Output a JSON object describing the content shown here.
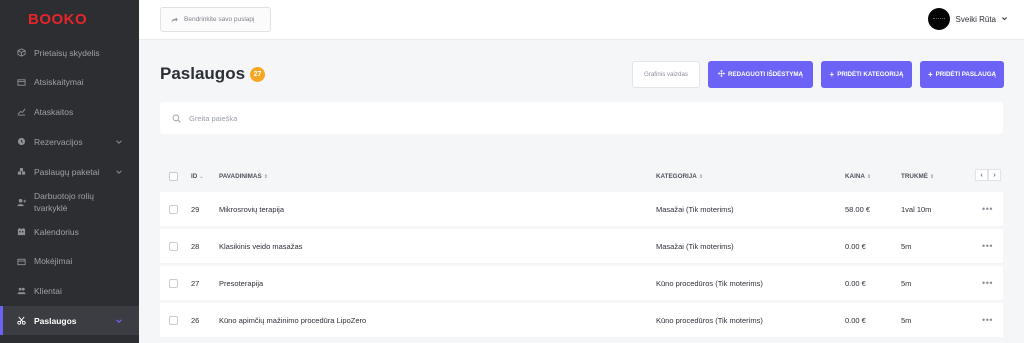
{
  "app": {
    "logo": "BOOKO"
  },
  "sidebar": {
    "items": [
      {
        "label": "Prietaisų skydelis",
        "icon": "cube-icon",
        "chevron": false,
        "active": false
      },
      {
        "label": "Atsiskaitymai",
        "icon": "card-icon",
        "chevron": false,
        "active": false
      },
      {
        "label": "Ataskaitos",
        "icon": "chart-icon",
        "chevron": false,
        "active": false
      },
      {
        "label": "Rezervacijos",
        "icon": "clock-icon",
        "chevron": true,
        "active": false
      },
      {
        "label": "Paslaugų paketai",
        "icon": "box-icon",
        "chevron": true,
        "active": false
      },
      {
        "label": "Darbuotojo rolių tvarkyklė",
        "icon": "user-plus-icon",
        "chevron": false,
        "active": false
      },
      {
        "label": "Kalendorius",
        "icon": "calendar-icon",
        "chevron": false,
        "active": false
      },
      {
        "label": "Mokėjimai",
        "icon": "wallet-icon",
        "chevron": false,
        "active": false
      },
      {
        "label": "Klientai",
        "icon": "users-icon",
        "chevron": false,
        "active": false
      },
      {
        "label": "Paslaugos",
        "icon": "scissors-icon",
        "chevron": true,
        "active": true
      }
    ]
  },
  "topbar": {
    "share_label": "Bendrinkite savo puslapį",
    "user_greeting": "Sveiki Rūta"
  },
  "header": {
    "title": "Paslaugos",
    "count": "27",
    "btn_graphic": "Grafinis vaizdas",
    "btn_edit": "REDAGUOTI IŠDĖSTYMĄ",
    "btn_add_category": "PRIDĖTI KATEGORIJĄ",
    "btn_add_service": "PRIDĖTI PASLAUGĄ"
  },
  "search": {
    "placeholder": "Greita paieška"
  },
  "table": {
    "columns": {
      "id": "ID",
      "name": "PAVADINIMAS",
      "category": "KATEGORIJA",
      "price": "KAINA",
      "duration": "TRUKMĖ"
    },
    "rows": [
      {
        "id": "29",
        "name": "Mikrosrovių terapija",
        "category": "Masažai (Tik moterims)",
        "price": "58.00 €",
        "duration": "1val 10m"
      },
      {
        "id": "28",
        "name": "Klasikinis veido masažas",
        "category": "Masažai (Tik moterims)",
        "price": "0.00 €",
        "duration": "5m"
      },
      {
        "id": "27",
        "name": "Presoterapija",
        "category": "Kūno procedūros (Tik moterims)",
        "price": "0.00 €",
        "duration": "5m"
      },
      {
        "id": "26",
        "name": "Kūno apimčių mažinimo procedūra LipoZero",
        "category": "Kūno procedūros (Tik moterims)",
        "price": "0.00 €",
        "duration": "5m"
      }
    ]
  },
  "colors": {
    "accent": "#6c63f6",
    "logo": "#e5252b",
    "badge": "#f6a623",
    "sidebar": "#2d2e31"
  }
}
